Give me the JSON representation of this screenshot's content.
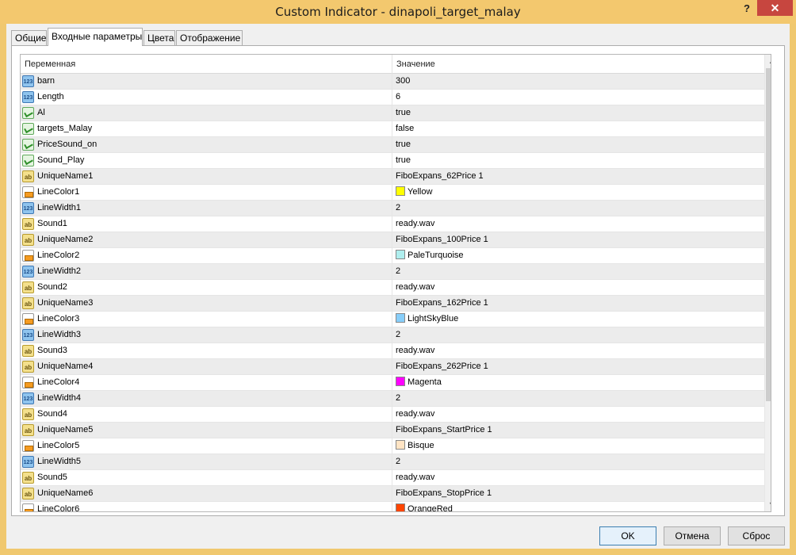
{
  "window": {
    "title": "Custom Indicator - dinapoli_target_malay",
    "help_label": "?",
    "close_label": "✕"
  },
  "tabs": [
    {
      "label": "Общие"
    },
    {
      "label": "Входные параметры"
    },
    {
      "label": "Цвета"
    },
    {
      "label": "Отображение"
    }
  ],
  "active_tab": "Входные параметры",
  "grid": {
    "col_variable": "Переменная",
    "col_value": "Значение"
  },
  "rows": [
    {
      "type": "int",
      "icon": "int-icon",
      "name": "barn",
      "value": "300"
    },
    {
      "type": "int",
      "icon": "int-icon",
      "name": "Length",
      "value": "6"
    },
    {
      "type": "bool",
      "icon": "bool-icon",
      "name": "Al",
      "value": "true"
    },
    {
      "type": "bool",
      "icon": "bool-icon",
      "name": "targets_Malay",
      "value": "false"
    },
    {
      "type": "bool",
      "icon": "bool-icon",
      "name": "PriceSound_on",
      "value": "true"
    },
    {
      "type": "bool",
      "icon": "bool-icon",
      "name": "Sound_Play",
      "value": "true"
    },
    {
      "type": "str",
      "icon": "string-icon",
      "name": "UniqueName1",
      "value": "FiboExpans_62Price 1"
    },
    {
      "type": "color",
      "icon": "color-icon",
      "name": "LineColor1",
      "value": "Yellow",
      "swatch": "#ffff00"
    },
    {
      "type": "int",
      "icon": "int-icon",
      "name": "LineWidth1",
      "value": "2"
    },
    {
      "type": "str",
      "icon": "string-icon",
      "name": "Sound1",
      "value": "ready.wav"
    },
    {
      "type": "str",
      "icon": "string-icon",
      "name": "UniqueName2",
      "value": "FiboExpans_100Price 1"
    },
    {
      "type": "color",
      "icon": "color-icon",
      "name": "LineColor2",
      "value": "PaleTurquoise",
      "swatch": "#afeeee"
    },
    {
      "type": "int",
      "icon": "int-icon",
      "name": "LineWidth2",
      "value": "2"
    },
    {
      "type": "str",
      "icon": "string-icon",
      "name": "Sound2",
      "value": "ready.wav"
    },
    {
      "type": "str",
      "icon": "string-icon",
      "name": "UniqueName3",
      "value": "FiboExpans_162Price 1"
    },
    {
      "type": "color",
      "icon": "color-icon",
      "name": "LineColor3",
      "value": "LightSkyBlue",
      "swatch": "#87cefa"
    },
    {
      "type": "int",
      "icon": "int-icon",
      "name": "LineWidth3",
      "value": "2"
    },
    {
      "type": "str",
      "icon": "string-icon",
      "name": "Sound3",
      "value": "ready.wav"
    },
    {
      "type": "str",
      "icon": "string-icon",
      "name": "UniqueName4",
      "value": "FiboExpans_262Price 1"
    },
    {
      "type": "color",
      "icon": "color-icon",
      "name": "LineColor4",
      "value": "Magenta",
      "swatch": "#ff00ff"
    },
    {
      "type": "int",
      "icon": "int-icon",
      "name": "LineWidth4",
      "value": "2"
    },
    {
      "type": "str",
      "icon": "string-icon",
      "name": "Sound4",
      "value": "ready.wav"
    },
    {
      "type": "str",
      "icon": "string-icon",
      "name": "UniqueName5",
      "value": "FiboExpans_StartPrice 1"
    },
    {
      "type": "color",
      "icon": "color-icon",
      "name": "LineColor5",
      "value": "Bisque",
      "swatch": "#ffe4c4"
    },
    {
      "type": "int",
      "icon": "int-icon",
      "name": "LineWidth5",
      "value": "2"
    },
    {
      "type": "str",
      "icon": "string-icon",
      "name": "Sound5",
      "value": "ready.wav"
    },
    {
      "type": "str",
      "icon": "string-icon",
      "name": "UniqueName6",
      "value": "FiboExpans_StopPrice 1"
    },
    {
      "type": "color",
      "icon": "color-icon",
      "name": "LineColor6",
      "value": "OrangeRed",
      "swatch": "#ff4500"
    }
  ],
  "buttons": {
    "ok": "OK",
    "cancel": "Отмена",
    "reset": "Сброс"
  },
  "scroll": {
    "up_glyph": "▲",
    "down_glyph": "▼"
  }
}
